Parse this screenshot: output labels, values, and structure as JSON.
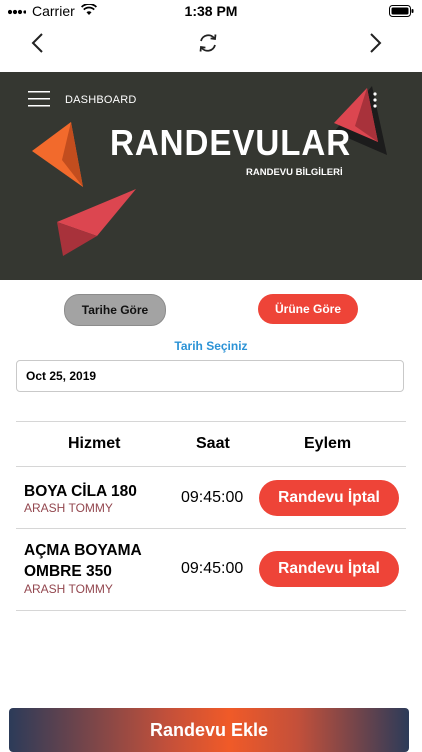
{
  "status_bar": {
    "carrier": "Carrier",
    "time": "1:38 PM"
  },
  "hero": {
    "menu_label": "DASHBOARD",
    "title": "RANDEVULAR",
    "subtitle": "RANDEVU BİLGİLERİ"
  },
  "filters": {
    "by_date": "Tarihe Göre",
    "by_product": "Ürüne Göre"
  },
  "date_picker": {
    "caption": "Tarih Seçiniz",
    "value": "Oct 25, 2019"
  },
  "table": {
    "headers": [
      "Hizmet",
      "Saat",
      "Eylem"
    ],
    "rows": [
      {
        "service": "BOYA CİLA 180",
        "customer": "ARASH TOMMY",
        "time": "09:45:00",
        "action": "Randevu İptal"
      },
      {
        "service": "AÇMA BOYAMA OMBRE 350",
        "customer": "ARASH TOMMY",
        "time": "09:45:00",
        "action": "Randevu İptal"
      }
    ]
  },
  "footer": {
    "add_button": "Randevu Ekle"
  },
  "colors": {
    "accent_red": "#ee4438",
    "hero_bg": "#353731",
    "link_blue": "#2c93d6",
    "customer_text": "#93474f"
  }
}
